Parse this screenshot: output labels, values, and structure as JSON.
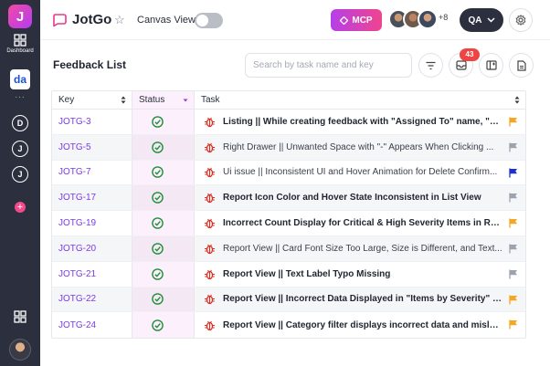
{
  "rail": {
    "logo_letter": "J",
    "dashboard_label": "Dashboard",
    "active_workspace": "da",
    "more": "...",
    "workspaces": [
      "D",
      "J",
      "J"
    ],
    "add": "+"
  },
  "header": {
    "app_title": "JotGo",
    "canvas_view_label": "Canvas View",
    "canvas_view_on": false,
    "mcp_label": "MCP",
    "extra_people": "+8",
    "role_label": "QA"
  },
  "toolbar": {
    "title": "Feedback List",
    "search_placeholder": "Search by task name and key",
    "notification_count": "43"
  },
  "table": {
    "headers": {
      "key": "Key",
      "status": "Status",
      "task": "Task"
    },
    "rows": [
      {
        "key": "JOTG-3",
        "task": "Listing || While creating feedback with \"Assigned To\" name, \"As...",
        "bold": true,
        "flag": "#f5a623"
      },
      {
        "key": "JOTG-5",
        "task": "Right Drawer || Unwanted Space with \"-\" Appears When Clicking ...",
        "bold": false,
        "flag": "#9ca3af"
      },
      {
        "key": "JOTG-7",
        "task": "Ui issue || Inconsistent UI and Hover Animation for Delete Confirm...",
        "bold": false,
        "flag": "#1d2fd1"
      },
      {
        "key": "JOTG-17",
        "task": "Report Icon Color and Hover State Inconsistent in List View",
        "bold": true,
        "flag": "#9ca3af"
      },
      {
        "key": "JOTG-19",
        "task": "Incorrect Count Display for Critical & High Severity Items in Repo...",
        "bold": true,
        "flag": "#f5a623"
      },
      {
        "key": "JOTG-20",
        "task": "Report View || Card Font Size Too Large, Size is Different, and Text...",
        "bold": false,
        "flag": "#9ca3af"
      },
      {
        "key": "JOTG-21",
        "task": "Report View || Text Label Typo Missing",
        "bold": true,
        "flag": "#9ca3af"
      },
      {
        "key": "JOTG-22",
        "task": "Report View || Incorrect Data Displayed in \"Items by Severity\" Pi...",
        "bold": true,
        "flag": "#f5a623"
      },
      {
        "key": "JOTG-24",
        "task": "Report View || Category filter displays incorrect data and mislab...",
        "bold": true,
        "flag": "#f5a623"
      }
    ]
  },
  "colors": {
    "rail_bg": "#2b2f3e",
    "accent_purple": "#7c3aed",
    "status_green": "#1f8f3a",
    "bug_red": "#d92d20",
    "badge_red": "#ef4444"
  }
}
